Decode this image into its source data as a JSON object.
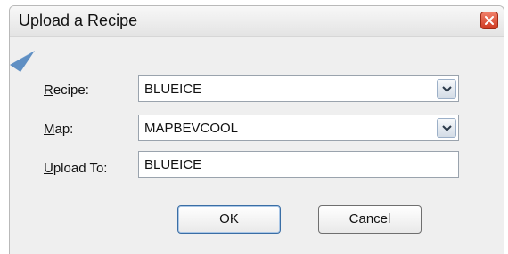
{
  "dialog": {
    "title": "Upload a Recipe",
    "close_icon": "close-icon"
  },
  "form": {
    "recipe": {
      "label_mnemonic": "R",
      "label_rest": "ecipe:",
      "value": "BLUEICE",
      "dropdown_icon": "chevron-down-icon"
    },
    "map": {
      "label_mnemonic": "M",
      "label_rest": "ap:",
      "value": "MAPBEVCOOL",
      "dropdown_icon": "chevron-down-icon"
    },
    "upload_to": {
      "label_mnemonic": "U",
      "label_rest": "pload To:",
      "value": "BLUEICE"
    }
  },
  "buttons": {
    "ok_label": "OK",
    "cancel_label": "Cancel"
  },
  "colors": {
    "dialog_background": "#efefef",
    "close_button": "#cf3b22",
    "default_button_border": "#3a6ea5",
    "cursor": "#5f8fc3"
  }
}
